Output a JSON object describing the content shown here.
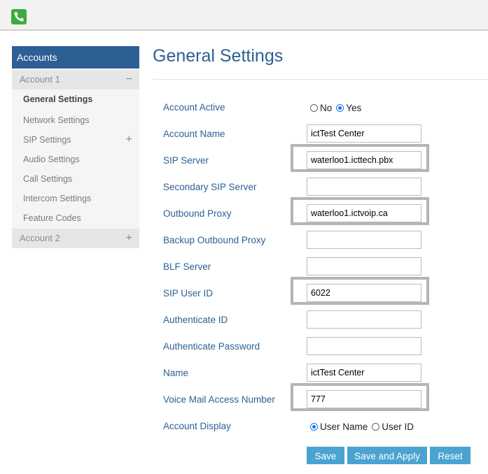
{
  "header": {
    "logo_icon": "phone-icon"
  },
  "sidebar": {
    "title": "Accounts",
    "account1": {
      "label": "Account 1",
      "toggle": "−"
    },
    "items": [
      {
        "label": "General Settings"
      },
      {
        "label": "Network Settings"
      },
      {
        "label": "SIP Settings",
        "expand": "+"
      },
      {
        "label": "Audio Settings"
      },
      {
        "label": "Call Settings"
      },
      {
        "label": "Intercom Settings"
      },
      {
        "label": "Feature Codes"
      }
    ],
    "account2": {
      "label": "Account 2",
      "toggle": "+"
    }
  },
  "page": {
    "title": "General Settings"
  },
  "form": {
    "account_active": {
      "label": "Account Active",
      "no": "No",
      "yes": "Yes",
      "selected": "Yes"
    },
    "account_name": {
      "label": "Account Name",
      "value": "ictTest Center"
    },
    "sip_server": {
      "label": "SIP Server",
      "value": "waterloo1.icttech.pbx"
    },
    "secondary_sip_server": {
      "label": "Secondary SIP Server",
      "value": ""
    },
    "outbound_proxy": {
      "label": "Outbound Proxy",
      "value": "waterloo1.ictvoip.ca"
    },
    "backup_outbound_proxy": {
      "label": "Backup Outbound Proxy",
      "value": ""
    },
    "blf_server": {
      "label": "BLF Server",
      "value": ""
    },
    "sip_user_id": {
      "label": "SIP User ID",
      "value": "6022"
    },
    "authenticate_id": {
      "label": "Authenticate ID",
      "value": ""
    },
    "authenticate_password": {
      "label": "Authenticate Password",
      "value": ""
    },
    "name": {
      "label": "Name",
      "value": "ictTest Center"
    },
    "voice_mail": {
      "label": "Voice Mail Access Number",
      "value": "777"
    },
    "account_display": {
      "label": "Account Display",
      "user_name": "User Name",
      "user_id": "User ID",
      "selected": "User Name"
    }
  },
  "buttons": {
    "save": "Save",
    "save_apply": "Save and Apply",
    "reset": "Reset"
  },
  "colors": {
    "accent": "#2d5f95",
    "button": "#4aa3d0",
    "logo": "#3dab3d",
    "highlight_border": "#b5b5b5"
  }
}
